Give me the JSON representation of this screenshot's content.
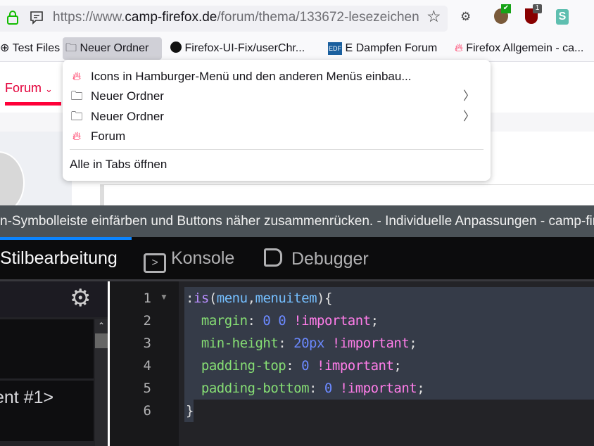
{
  "browser": {
    "url_prefix": "https://www.",
    "url_domain": "camp-firefox.de",
    "url_path": "/forum/thema/133672-lesezeichen",
    "extension_badge": "1"
  },
  "bookmarks": [
    {
      "label": "Test Files",
      "icon": "globe-icon"
    },
    {
      "label": "Neuer Ordner",
      "icon": "folder-icon"
    },
    {
      "label": "Firefox-UI-Fix/userChr...",
      "icon": "github-icon"
    },
    {
      "label": "E Dampfen Forum",
      "icon": "edf-icon",
      "icon_text": "EDF"
    },
    {
      "label": "Firefox Allgemein - ca...",
      "icon": "flame-icon"
    }
  ],
  "page": {
    "nav_forum": "Forum",
    "nav_chevron": "⌄"
  },
  "menu": {
    "items": [
      {
        "label": "Icons in Hamburger-Menü und den anderen Menüs einbau...",
        "icon": "flame-icon"
      },
      {
        "label": "Neuer Ordner",
        "icon": "folder-icon",
        "submenu": true
      },
      {
        "label": "Neuer Ordner",
        "icon": "folder-icon",
        "submenu": true
      },
      {
        "label": "Forum",
        "icon": "flame-icon"
      }
    ],
    "open_all": "Alle in Tabs öffnen"
  },
  "devtools": {
    "window_title": "n-Symbolleiste einfärben und Buttons näher zusammenrücken. - Individuelle Anpassungen - camp-firefox.de",
    "tabs": [
      "Stilbearbeitung",
      "Konsole",
      "Debugger"
    ],
    "sheet_label": "ent #1>",
    "line_numbers": [
      "1",
      "2",
      "3",
      "4",
      "5",
      "6"
    ],
    "colors": {
      "property": "#86de74",
      "number": "#6b89ff",
      "important": "#ff7de9",
      "accent": "#0a84ff"
    }
  }
}
